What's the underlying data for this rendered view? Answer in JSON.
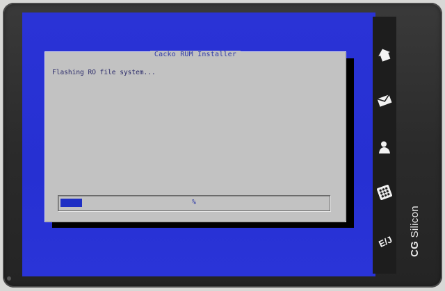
{
  "installer": {
    "title": "Cacko RUM Installer",
    "message": "Flashing RO file system...",
    "progress": {
      "percent_label": "%",
      "fraction": 0.08
    }
  },
  "side_buttons": [
    {
      "icon": "home-icon"
    },
    {
      "icon": "mail-icon"
    },
    {
      "icon": "person-icon"
    },
    {
      "icon": "keypad-icon"
    },
    {
      "icon": "language-icon",
      "label": "E/J"
    }
  ],
  "brand": {
    "logo": "CG",
    "name": "Silicon"
  },
  "colors": {
    "screen_blue": "#2630d2",
    "dialog_gray": "#c2c2c2",
    "progress_blue": "#1f2fc4",
    "bezel": "#2b2b2b"
  }
}
